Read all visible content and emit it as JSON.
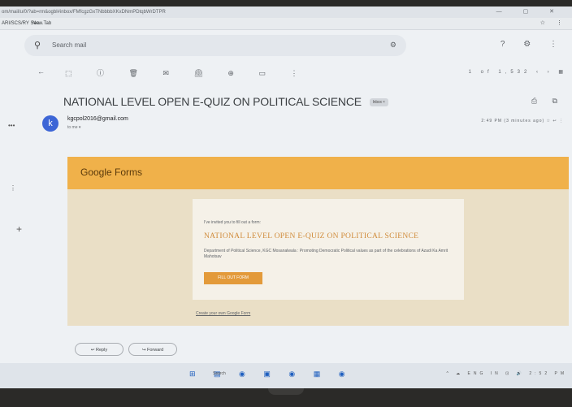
{
  "browser": {
    "url": "om/mail/u/0/?ab=rm&ogbl#inbox/FMfcgzGxTNbbbbXKxDNmPDtqbWrDTPR",
    "bookmarks": [
      "ARI/SCS/RY Sea...",
      "New Tab"
    ],
    "window_controls": "— ▢ ✕",
    "toolbar_icons": "☆ ⋮"
  },
  "gmail": {
    "search_placeholder": "Search mail",
    "filter_icon": "⚙",
    "top_icons": "? ⚙ ⋮",
    "toolbar_back": "←",
    "toolbar_tools": "⬚ ⓘ 🗑 ✉ ⏲ ⊕ ▭ ⋮",
    "pager": "1 of 1,532 ‹ › ▦",
    "subject": "NATIONAL LEVEL OPEN E-QUIZ ON POLITICAL SCIENCE",
    "inbox_tag": "Inbox ×",
    "subject_icons": "⎙ ⧉",
    "avatar_letter": "k",
    "sender": "kgcpol2016@gmail.com",
    "to_me": "to me ▾",
    "meta": "2:49 PM (3 minutes ago) ☆ ↩ ⋮",
    "reply_label": "↩ Reply",
    "forward_label": "↪ Forward"
  },
  "forms": {
    "brand": "Google Forms",
    "invite_text": "I've invited you to fill out a form:",
    "title": "NATIONAL LEVEL OPEN E-QUIZ ON POLITICAL SCIENCE",
    "description": "Department of Political Science, KGC Mosanalwala : Promoting Democratic Political values as part of the celebrations of Azadi Ka Amrit Mahotsav",
    "fill_button": "FILL OUT FORM",
    "create_link": "Create your own Google Form"
  },
  "taskbar": {
    "start_icons": "⊞  ▤ ◉ ▣ ◉ ▦ ◉",
    "search_label": "Search",
    "tray": "^ ☁ ENG IN ⊡ 🔊 2:52 PM"
  }
}
